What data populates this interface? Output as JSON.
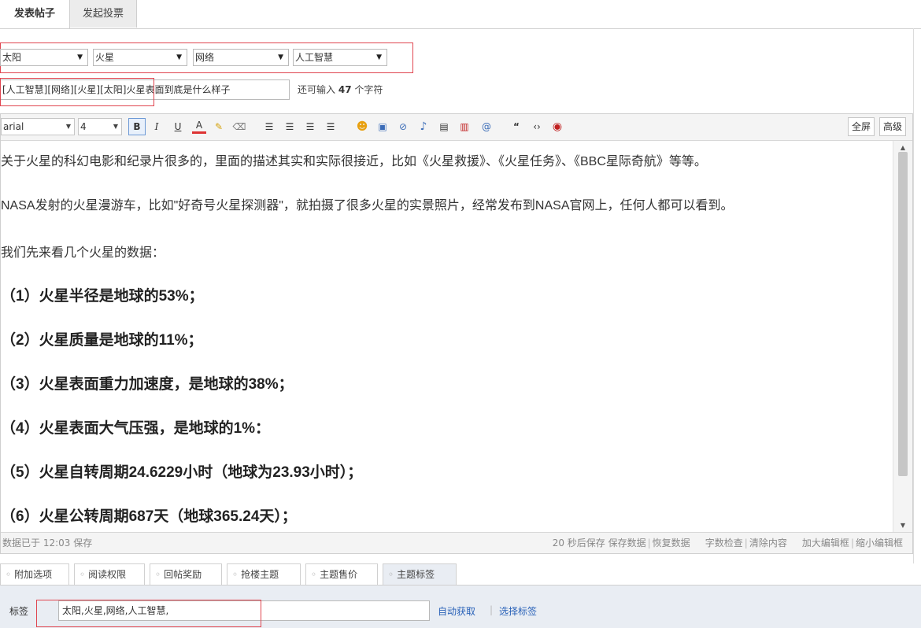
{
  "tabs": {
    "post": "发表帖子",
    "poll": "发起投票"
  },
  "categories": [
    "太阳",
    "火星",
    "网络",
    "人工智慧"
  ],
  "title": {
    "value": "[人工智慧][网络][火星][太阳]火星表面到底是什么样子",
    "hint_prefix": "还可输入",
    "remaining": "47",
    "hint_suffix": "个字符"
  },
  "toolbar": {
    "font": "arial",
    "size": "4",
    "bold": "B",
    "italic": "I",
    "underline": "U",
    "forecolor": "A",
    "fullscreen": "全屏",
    "advanced": "高级"
  },
  "content": {
    "paragraphs": [
      "关于火星的科幻电影和纪录片很多的，里面的描述其实和实际很接近，比如《火星救援》、《火星任务》、《BBC星际奇航》等等。",
      "NASA发射的火星漫游车，比如\"好奇号火星探测器\"，就拍摄了很多火星的实景照片，经常发布到NASA官网上，任何人都可以看到。",
      "我们先来看几个火星的数据："
    ],
    "stats": [
      "（1）火星半径是地球的53%；",
      "（2）火星质量是地球的11%；",
      "（3）火星表面重力加速度，是地球的38%；",
      "（4）火星表面大气压强，是地球的1%：",
      "（5）火星自转周期24.6229小时（地球为23.93小时）；",
      "（6）火星公转周期687天（地球365.24天）；"
    ]
  },
  "status": {
    "saved": "数据已于 12:03 保存",
    "autosave": "20 秒后保存",
    "save_data": "保存数据",
    "restore": "恢复数据",
    "word_check": "字数检查",
    "clear": "清除内容",
    "enlarge": "加大编辑框",
    "shrink": "缩小编辑框"
  },
  "bottom_tabs": [
    "附加选项",
    "阅读权限",
    "回帖奖励",
    "抢楼主题",
    "主题售价",
    "主题标签"
  ],
  "tags": {
    "label": "标签",
    "value": "太阳,火星,网络,人工智慧,",
    "auto": "自动获取",
    "choose": "选择标签"
  },
  "colors": {
    "highlight_red": "#e0454f",
    "link_blue": "#2a62b8"
  }
}
